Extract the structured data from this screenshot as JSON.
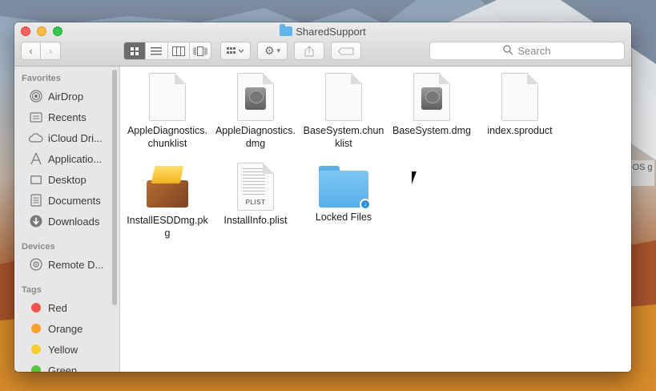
{
  "window": {
    "title": "SharedSupport"
  },
  "toolbar": {
    "back": "‹",
    "forward": "›",
    "views": [
      "grid",
      "list",
      "columns",
      "cover flow"
    ],
    "search_placeholder": "Search"
  },
  "sidebar": {
    "favorites_header": "Favorites",
    "favorites": [
      {
        "label": "AirDrop",
        "icon": "airdrop-icon"
      },
      {
        "label": "Recents",
        "icon": "recents-icon"
      },
      {
        "label": "iCloud Dri...",
        "icon": "icloud-icon"
      },
      {
        "label": "Applicatio...",
        "icon": "applications-icon"
      },
      {
        "label": "Desktop",
        "icon": "desktop-icon"
      },
      {
        "label": "Documents",
        "icon": "documents-icon"
      },
      {
        "label": "Downloads",
        "icon": "downloads-icon"
      }
    ],
    "devices_header": "Devices",
    "devices": [
      {
        "label": "Remote D...",
        "icon": "remote-disc-icon"
      }
    ],
    "tags_header": "Tags",
    "tags": [
      {
        "label": "Red",
        "color": "#f4534b"
      },
      {
        "label": "Orange",
        "color": "#f9a12e"
      },
      {
        "label": "Yellow",
        "color": "#f7ce2f"
      },
      {
        "label": "Green",
        "color": "#57c23b"
      }
    ]
  },
  "files": [
    {
      "name": "AppleDiagnostics.chunklist",
      "line1": "AppleDiagnostics.",
      "line2": "chunklist",
      "kind": "document"
    },
    {
      "name": "AppleDiagnostics.dmg",
      "line1": "AppleDiagnostics.",
      "line2": "dmg",
      "kind": "disk-image"
    },
    {
      "name": "BaseSystem.chunklist",
      "line1": "BaseSystem.chun",
      "line2": "klist",
      "kind": "document"
    },
    {
      "name": "BaseSystem.dmg",
      "line1": "BaseSystem.dmg",
      "line2": "",
      "kind": "disk-image"
    },
    {
      "name": "index.sproduct",
      "line1": "index.sproduct",
      "line2": "",
      "kind": "document"
    },
    {
      "name": "InstallESDDmg.pkg",
      "line1": "InstallESDDmg.pk",
      "line2": "g",
      "kind": "package"
    },
    {
      "name": "InstallInfo.plist",
      "line1": "InstallInfo.plist",
      "line2": "",
      "kind": "plist",
      "badge": "PLIST"
    },
    {
      "name": "Locked Files",
      "line1": "Locked Files",
      "line2": "",
      "kind": "folder"
    }
  ],
  "background_window_text": "OS\ng"
}
